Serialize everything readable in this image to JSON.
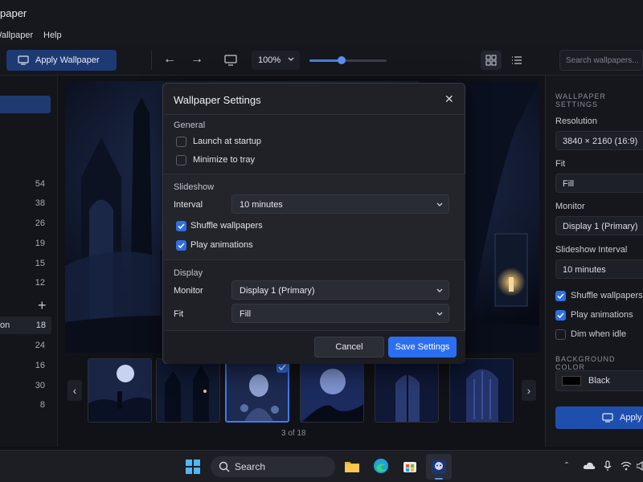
{
  "window": {
    "title": "paper"
  },
  "menu": [
    "Wallpaper",
    "Help"
  ],
  "toolbar": {
    "apply_label": "Apply Wallpaper",
    "zoom": "100%",
    "zoom_slider_level": 0.42,
    "search_placeholder": "Search wallpapers..."
  },
  "sidebar": {
    "counts": [
      "54",
      "38",
      "26",
      "19",
      "15",
      "12"
    ],
    "selected_label": "on",
    "selected_count": "18",
    "counts_after": [
      "24",
      "16",
      "30",
      "8"
    ]
  },
  "thumbs": {
    "pager": "3 of 18",
    "selected_index": 2
  },
  "right_panel": {
    "heading": "WALLPAPER SETTINGS",
    "resolution_label": "Resolution",
    "resolution_value": "3840 × 2160 (16:9)",
    "fit_label": "Fit",
    "fit_value": "Fill",
    "monitor_label": "Monitor",
    "monitor_value": "Display 1 (Primary)",
    "interval_label": "Slideshow Interval",
    "interval_value": "10 minutes",
    "shuffle": "Shuffle wallpapers",
    "animations": "Play animations",
    "dim": "Dim when idle",
    "bg_heading": "BACKGROUND COLOR",
    "bg_value": "Black",
    "apply_label": "Apply"
  },
  "dialog": {
    "title": "Wallpaper Settings",
    "general": "General",
    "launch": "Launch at startup",
    "minimize": "Minimize to tray",
    "slideshow": "Slideshow",
    "interval_label": "Interval",
    "interval_value": "10 minutes",
    "shuffle": "Shuffle wallpapers",
    "animations": "Play animations",
    "display": "Display",
    "monitor_label": "Monitor",
    "monitor_value": "Display 1 (Primary)",
    "fit_label": "Fit",
    "fit_value": "Fill",
    "cancel": "Cancel",
    "save": "Save Settings"
  },
  "taskbar": {
    "search": "Search"
  }
}
